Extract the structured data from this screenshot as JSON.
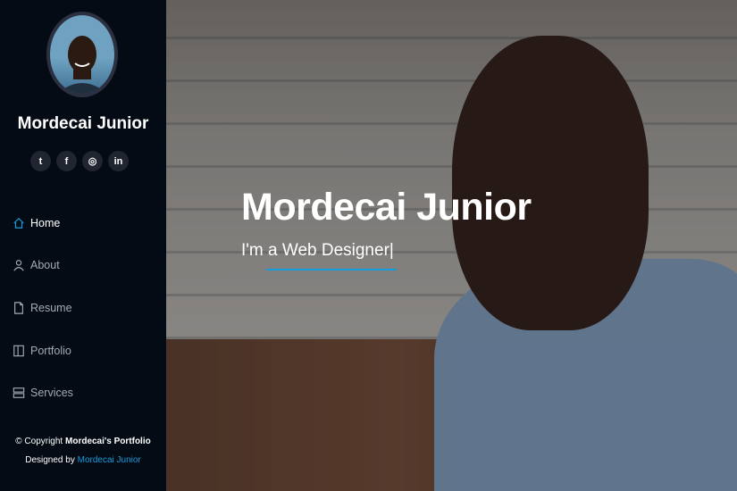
{
  "profile": {
    "name": "Mordecai Junior"
  },
  "social": [
    {
      "name": "twitter-icon",
      "glyph": "t"
    },
    {
      "name": "facebook-icon",
      "glyph": "f"
    },
    {
      "name": "instagram-icon",
      "glyph": "◎"
    },
    {
      "name": "linkedin-icon",
      "glyph": "in"
    }
  ],
  "nav": {
    "items": [
      {
        "label": "Home",
        "icon": "house-icon",
        "active": true
      },
      {
        "label": "About",
        "icon": "person-icon"
      },
      {
        "label": "Resume",
        "icon": "file-icon"
      },
      {
        "label": "Portfolio",
        "icon": "book-icon"
      },
      {
        "label": "Services",
        "icon": "server-icon"
      }
    ]
  },
  "footer": {
    "copyright_prefix": "© Copyright",
    "brand": "Mordecai's Portfolio",
    "designed_prefix": "Designed by",
    "designed_by": "Mordecai Junior"
  },
  "hero": {
    "title": "Mordecai Junior",
    "subtitle": "I'm a Web Designer|"
  },
  "colors": {
    "accent": "#149ddd",
    "sidebar_bg": "#040b14"
  }
}
